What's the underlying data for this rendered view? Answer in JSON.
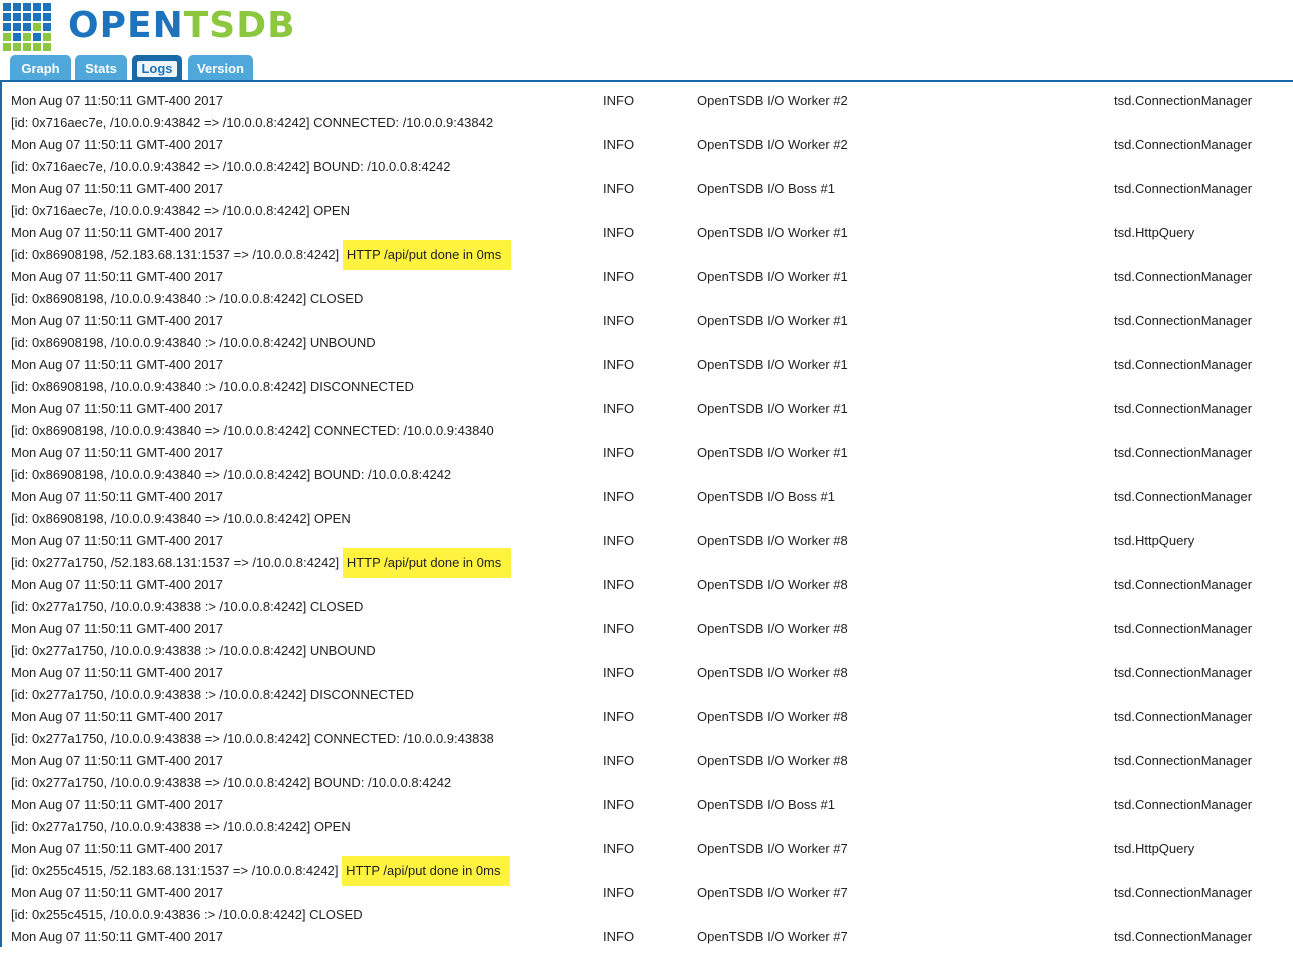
{
  "app": {
    "logo_left": "OPEN",
    "logo_right": "TSDB",
    "brand_blue": "#1d74bd",
    "brand_green": "#8dc63f",
    "logo_icon": "grid-chart-icon"
  },
  "tabs": [
    {
      "label": "Graph",
      "active": false
    },
    {
      "label": "Stats",
      "active": false
    },
    {
      "label": "Logs",
      "active": true
    },
    {
      "label": "Version",
      "active": false
    }
  ],
  "highlight_color": "#fff33f",
  "log_entries": [
    {
      "time": "Mon Aug 07 11:50:11 GMT-400 2017",
      "level": "INFO",
      "thread": "OpenTSDB I/O Worker #2",
      "class": "tsd.ConnectionManager",
      "message": "[id: 0x716aec7e, /10.0.0.9:43842 => /10.0.0.8:4242] CONNECTED: /10.0.0.9:43842",
      "highlight": ""
    },
    {
      "time": "Mon Aug 07 11:50:11 GMT-400 2017",
      "level": "INFO",
      "thread": "OpenTSDB I/O Worker #2",
      "class": "tsd.ConnectionManager",
      "message": "[id: 0x716aec7e, /10.0.0.9:43842 => /10.0.0.8:4242] BOUND: /10.0.0.8:4242",
      "highlight": ""
    },
    {
      "time": "Mon Aug 07 11:50:11 GMT-400 2017",
      "level": "INFO",
      "thread": "OpenTSDB I/O Boss #1",
      "class": "tsd.ConnectionManager",
      "message": "[id: 0x716aec7e, /10.0.0.9:43842 => /10.0.0.8:4242] OPEN",
      "highlight": ""
    },
    {
      "time": "Mon Aug 07 11:50:11 GMT-400 2017",
      "level": "INFO",
      "thread": "OpenTSDB I/O Worker #1",
      "class": "tsd.HttpQuery",
      "message": "[id: 0x86908198, /52.183.68.131:1537 => /10.0.0.8:4242]",
      "highlight": "HTTP /api/put done in 0ms"
    },
    {
      "time": "Mon Aug 07 11:50:11 GMT-400 2017",
      "level": "INFO",
      "thread": "OpenTSDB I/O Worker #1",
      "class": "tsd.ConnectionManager",
      "message": "[id: 0x86908198, /10.0.0.9:43840 :> /10.0.0.8:4242] CLOSED",
      "highlight": ""
    },
    {
      "time": "Mon Aug 07 11:50:11 GMT-400 2017",
      "level": "INFO",
      "thread": "OpenTSDB I/O Worker #1",
      "class": "tsd.ConnectionManager",
      "message": "[id: 0x86908198, /10.0.0.9:43840 :> /10.0.0.8:4242] UNBOUND",
      "highlight": ""
    },
    {
      "time": "Mon Aug 07 11:50:11 GMT-400 2017",
      "level": "INFO",
      "thread": "OpenTSDB I/O Worker #1",
      "class": "tsd.ConnectionManager",
      "message": "[id: 0x86908198, /10.0.0.9:43840 :> /10.0.0.8:4242] DISCONNECTED",
      "highlight": ""
    },
    {
      "time": "Mon Aug 07 11:50:11 GMT-400 2017",
      "level": "INFO",
      "thread": "OpenTSDB I/O Worker #1",
      "class": "tsd.ConnectionManager",
      "message": "[id: 0x86908198, /10.0.0.9:43840 => /10.0.0.8:4242] CONNECTED: /10.0.0.9:43840",
      "highlight": ""
    },
    {
      "time": "Mon Aug 07 11:50:11 GMT-400 2017",
      "level": "INFO",
      "thread": "OpenTSDB I/O Worker #1",
      "class": "tsd.ConnectionManager",
      "message": "[id: 0x86908198, /10.0.0.9:43840 => /10.0.0.8:4242] BOUND: /10.0.0.8:4242",
      "highlight": ""
    },
    {
      "time": "Mon Aug 07 11:50:11 GMT-400 2017",
      "level": "INFO",
      "thread": "OpenTSDB I/O Boss #1",
      "class": "tsd.ConnectionManager",
      "message": "[id: 0x86908198, /10.0.0.9:43840 => /10.0.0.8:4242] OPEN",
      "highlight": ""
    },
    {
      "time": "Mon Aug 07 11:50:11 GMT-400 2017",
      "level": "INFO",
      "thread": "OpenTSDB I/O Worker #8",
      "class": "tsd.HttpQuery",
      "message": "[id: 0x277a1750, /52.183.68.131:1537 => /10.0.0.8:4242]",
      "highlight": "HTTP /api/put done in 0ms"
    },
    {
      "time": "Mon Aug 07 11:50:11 GMT-400 2017",
      "level": "INFO",
      "thread": "OpenTSDB I/O Worker #8",
      "class": "tsd.ConnectionManager",
      "message": "[id: 0x277a1750, /10.0.0.9:43838 :> /10.0.0.8:4242] CLOSED",
      "highlight": ""
    },
    {
      "time": "Mon Aug 07 11:50:11 GMT-400 2017",
      "level": "INFO",
      "thread": "OpenTSDB I/O Worker #8",
      "class": "tsd.ConnectionManager",
      "message": "[id: 0x277a1750, /10.0.0.9:43838 :> /10.0.0.8:4242] UNBOUND",
      "highlight": ""
    },
    {
      "time": "Mon Aug 07 11:50:11 GMT-400 2017",
      "level": "INFO",
      "thread": "OpenTSDB I/O Worker #8",
      "class": "tsd.ConnectionManager",
      "message": "[id: 0x277a1750, /10.0.0.9:43838 :> /10.0.0.8:4242] DISCONNECTED",
      "highlight": ""
    },
    {
      "time": "Mon Aug 07 11:50:11 GMT-400 2017",
      "level": "INFO",
      "thread": "OpenTSDB I/O Worker #8",
      "class": "tsd.ConnectionManager",
      "message": "[id: 0x277a1750, /10.0.0.9:43838 => /10.0.0.8:4242] CONNECTED: /10.0.0.9:43838",
      "highlight": ""
    },
    {
      "time": "Mon Aug 07 11:50:11 GMT-400 2017",
      "level": "INFO",
      "thread": "OpenTSDB I/O Worker #8",
      "class": "tsd.ConnectionManager",
      "message": "[id: 0x277a1750, /10.0.0.9:43838 => /10.0.0.8:4242] BOUND: /10.0.0.8:4242",
      "highlight": ""
    },
    {
      "time": "Mon Aug 07 11:50:11 GMT-400 2017",
      "level": "INFO",
      "thread": "OpenTSDB I/O Boss #1",
      "class": "tsd.ConnectionManager",
      "message": "[id: 0x277a1750, /10.0.0.9:43838 => /10.0.0.8:4242] OPEN",
      "highlight": ""
    },
    {
      "time": "Mon Aug 07 11:50:11 GMT-400 2017",
      "level": "INFO",
      "thread": "OpenTSDB I/O Worker #7",
      "class": "tsd.HttpQuery",
      "message": "[id: 0x255c4515, /52.183.68.131:1537 => /10.0.0.8:4242]",
      "highlight": "HTTP /api/put done in 0ms"
    },
    {
      "time": "Mon Aug 07 11:50:11 GMT-400 2017",
      "level": "INFO",
      "thread": "OpenTSDB I/O Worker #7",
      "class": "tsd.ConnectionManager",
      "message": "[id: 0x255c4515, /10.0.0.9:43836 :> /10.0.0.8:4242] CLOSED",
      "highlight": ""
    },
    {
      "time": "Mon Aug 07 11:50:11 GMT-400 2017",
      "level": "INFO",
      "thread": "OpenTSDB I/O Worker #7",
      "class": "tsd.ConnectionManager",
      "message": "",
      "highlight": ""
    }
  ]
}
